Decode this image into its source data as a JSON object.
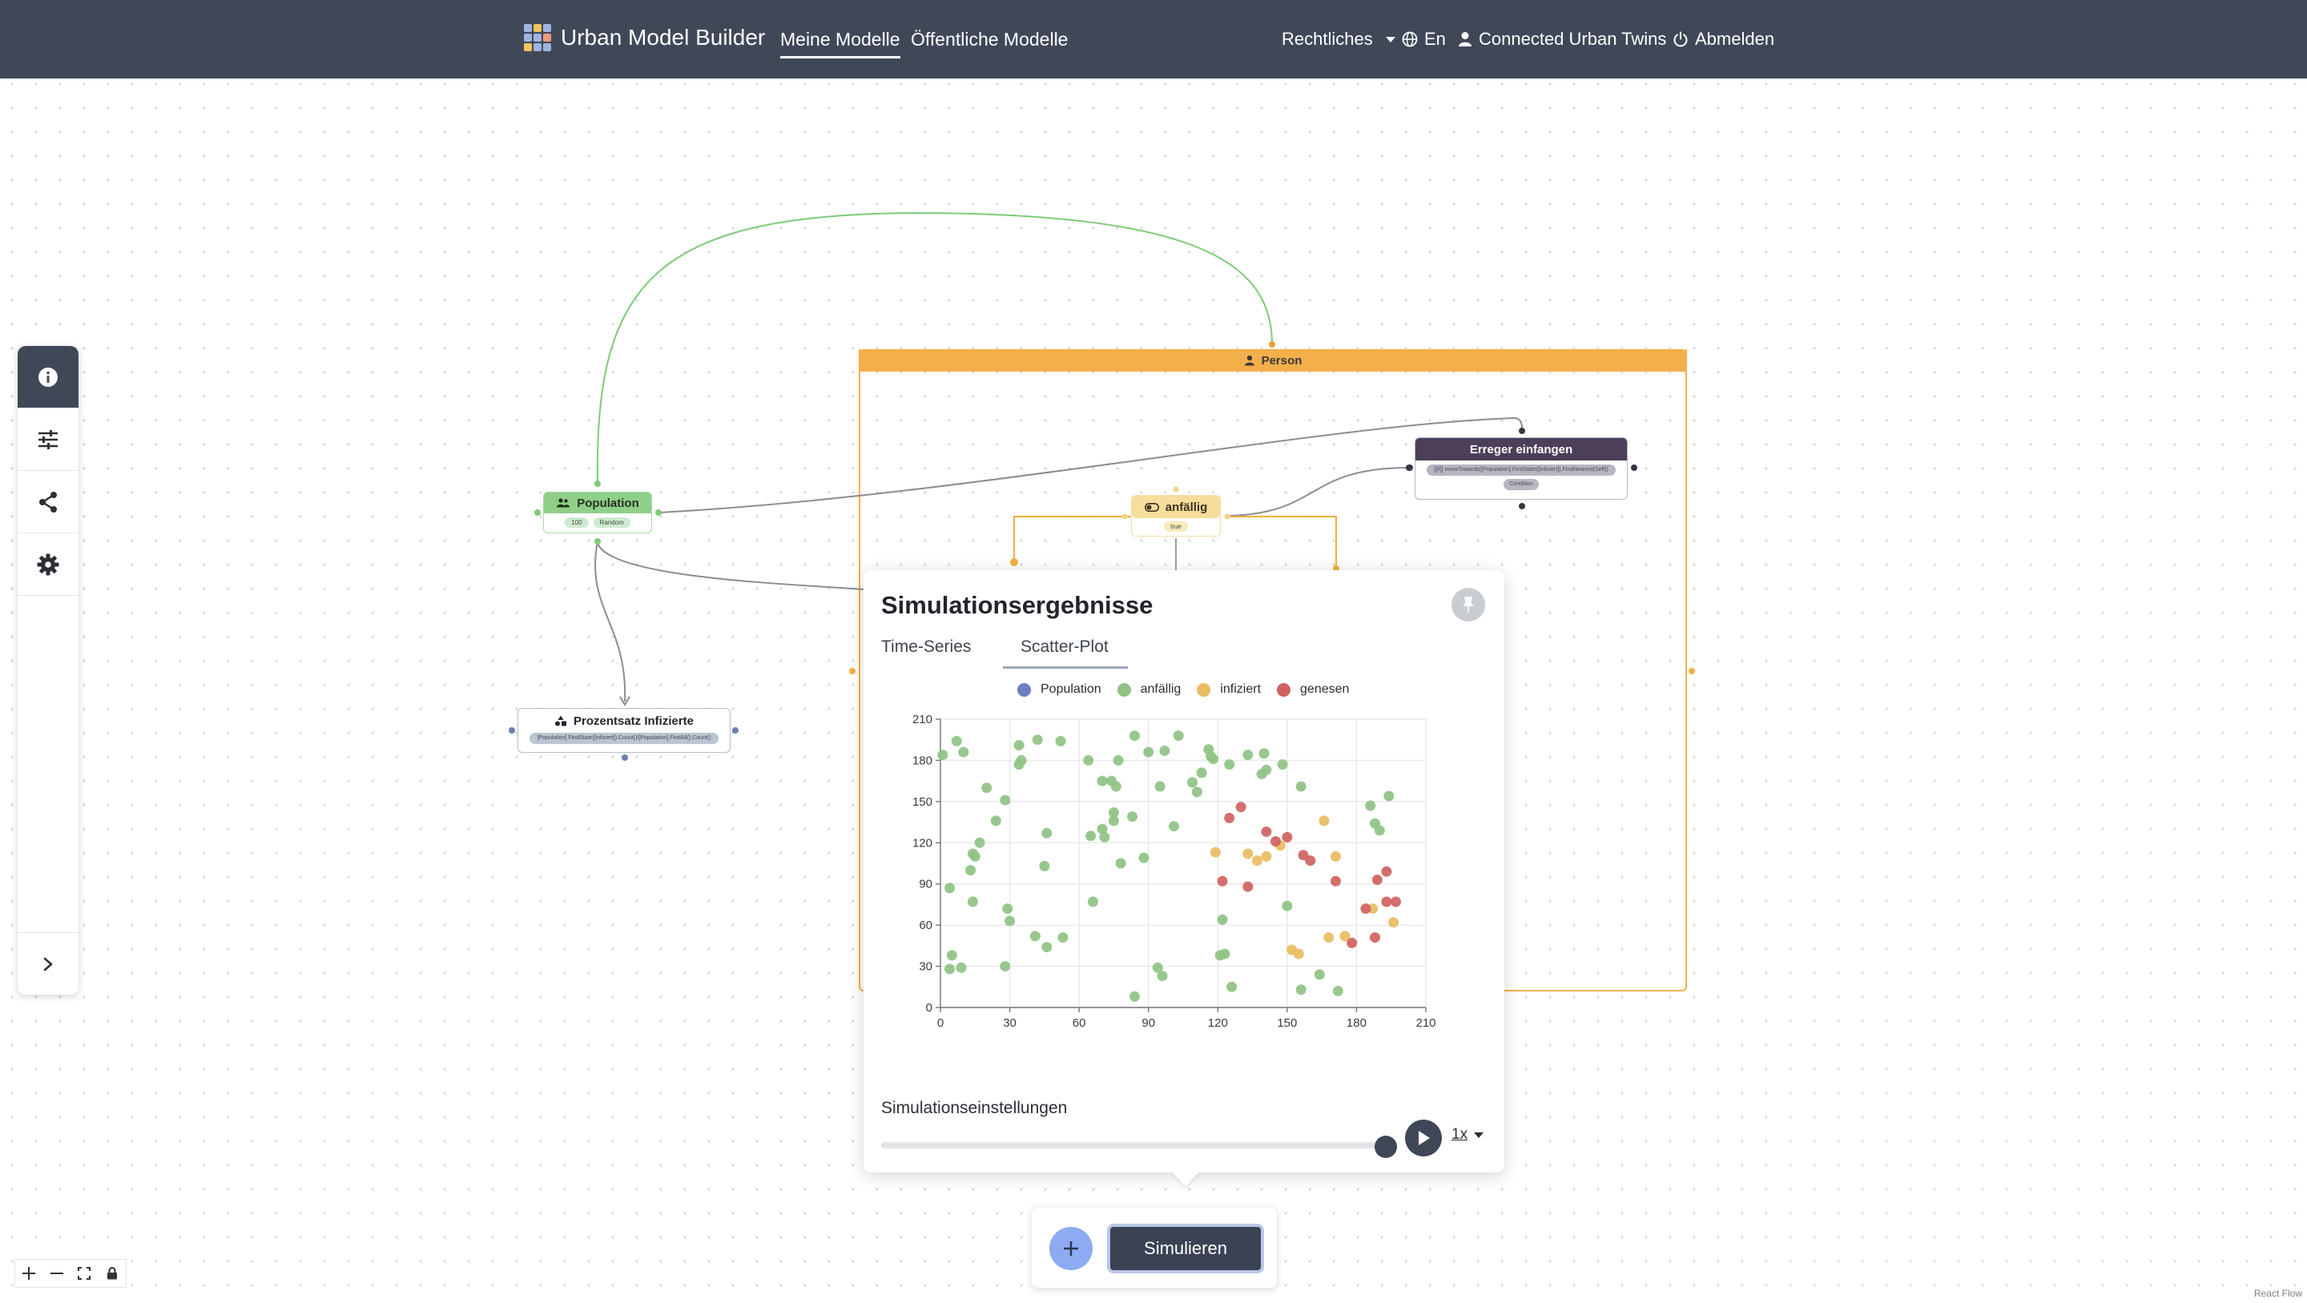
{
  "navbar": {
    "brand": "Urban Model Builder",
    "links": [
      {
        "label": "Meine Modelle",
        "active": true
      },
      {
        "label": "Öffentliche Modelle",
        "active": false
      }
    ],
    "legal": "Rechtliches",
    "language": "En",
    "user": "Connected Urban Twins",
    "logout": "Abmelden"
  },
  "colors": {
    "navbar": "#404858",
    "population": "#8fcf88",
    "person": "#f3af4a",
    "anfaellig": "#f7dd9c",
    "erreger": "#4b3f5a"
  },
  "sidebar": {
    "icons": [
      "info-icon",
      "sliders-icon",
      "share-icon",
      "gear-icon"
    ],
    "collapse_icon": "chevron-right-icon"
  },
  "nodes": {
    "person": {
      "label": "Person"
    },
    "population": {
      "label": "Population",
      "pills": [
        "100",
        "Random"
      ]
    },
    "anfaellig": {
      "label": "anfällig",
      "pill": "true"
    },
    "erreger": {
      "label": "Erreger einfangen",
      "formula": "[[if]] moveTowards([Population].FindState([infiziert]).FindNearest(Self))",
      "pill": "Condition"
    },
    "prozentsatz": {
      "label": "Prozentsatz Infizierte",
      "formula": "[Population].FindState([infiziert]).Count()/[Population].FindAll().Count()"
    }
  },
  "simulation": {
    "title": "Simulationsergebnisse",
    "tabs": [
      {
        "label": "Time-Series",
        "active": false
      },
      {
        "label": "Scatter-Plot",
        "active": true
      }
    ],
    "settings_label": "Simulationseinstellungen",
    "speed": "1x",
    "progress": 1.0
  },
  "chart_data": {
    "type": "scatter",
    "xlim": [
      0,
      210
    ],
    "ylim": [
      0,
      210
    ],
    "xticks": [
      0,
      30,
      60,
      90,
      120,
      150,
      180,
      210
    ],
    "yticks": [
      0,
      30,
      60,
      90,
      120,
      150,
      180,
      210
    ],
    "grid": true,
    "legend": "top",
    "series": [
      {
        "name": "Population",
        "color": "#6a7fc0",
        "points": []
      },
      {
        "name": "anfällig",
        "color": "#8fc283",
        "points": [
          [
            1,
            184
          ],
          [
            7,
            194
          ],
          [
            10,
            186
          ],
          [
            20,
            160
          ],
          [
            28,
            151
          ],
          [
            24,
            136
          ],
          [
            14,
            112
          ],
          [
            17,
            120
          ],
          [
            13,
            100
          ],
          [
            15,
            110
          ],
          [
            4,
            87
          ],
          [
            14,
            77
          ],
          [
            5,
            38
          ],
          [
            4,
            28
          ],
          [
            9,
            29
          ],
          [
            29,
            72
          ],
          [
            30,
            63
          ],
          [
            28,
            30
          ],
          [
            34,
            191
          ],
          [
            35,
            180
          ],
          [
            34,
            177
          ],
          [
            42,
            195
          ],
          [
            46,
            127
          ],
          [
            45,
            103
          ],
          [
            52,
            194
          ],
          [
            41,
            52
          ],
          [
            46,
            44
          ],
          [
            53,
            51
          ],
          [
            64,
            180
          ],
          [
            70,
            165
          ],
          [
            65,
            125
          ],
          [
            70,
            130
          ],
          [
            71,
            124
          ],
          [
            75,
            136
          ],
          [
            76,
            161
          ],
          [
            77,
            180
          ],
          [
            74,
            165
          ],
          [
            75,
            142
          ],
          [
            78,
            105
          ],
          [
            66,
            77
          ],
          [
            83,
            139
          ],
          [
            84,
            198
          ],
          [
            88,
            109
          ],
          [
            90,
            186
          ],
          [
            97,
            187
          ],
          [
            95,
            161
          ],
          [
            101,
            132
          ],
          [
            103,
            198
          ],
          [
            109,
            164
          ],
          [
            111,
            157
          ],
          [
            113,
            171
          ],
          [
            116,
            188
          ],
          [
            117,
            183
          ],
          [
            118,
            181
          ],
          [
            122,
            64
          ],
          [
            123,
            39
          ],
          [
            125,
            177
          ],
          [
            121,
            38
          ],
          [
            126,
            15
          ],
          [
            133,
            184
          ],
          [
            139,
            170
          ],
          [
            141,
            173
          ],
          [
            140,
            185
          ],
          [
            148,
            177
          ],
          [
            156,
            161
          ],
          [
            150,
            74
          ],
          [
            156,
            13
          ],
          [
            164,
            24
          ],
          [
            172,
            12
          ],
          [
            190,
            129
          ],
          [
            186,
            147
          ],
          [
            188,
            134
          ],
          [
            194,
            154
          ],
          [
            84,
            8
          ],
          [
            94,
            29
          ],
          [
            96,
            23
          ]
        ]
      },
      {
        "name": "infiziert",
        "color": "#e8bc61",
        "points": [
          [
            119,
            113
          ],
          [
            133,
            112
          ],
          [
            137,
            107
          ],
          [
            141,
            110
          ],
          [
            147,
            118
          ],
          [
            166,
            136
          ],
          [
            168,
            51
          ],
          [
            171,
            110
          ],
          [
            175,
            52
          ],
          [
            187,
            72
          ],
          [
            196,
            62
          ],
          [
            152,
            42
          ],
          [
            155,
            39
          ]
        ]
      },
      {
        "name": "genesen",
        "color": "#d06262",
        "points": [
          [
            125,
            138
          ],
          [
            130,
            146
          ],
          [
            122,
            92
          ],
          [
            133,
            88
          ],
          [
            141,
            128
          ],
          [
            145,
            121
          ],
          [
            150,
            124
          ],
          [
            157,
            111
          ],
          [
            160,
            107
          ],
          [
            171,
            92
          ],
          [
            178,
            47
          ],
          [
            184,
            72
          ],
          [
            188,
            51
          ],
          [
            189,
            93
          ],
          [
            193,
            99
          ],
          [
            193,
            77
          ],
          [
            197,
            77
          ]
        ]
      }
    ]
  },
  "toolbar": {
    "add_icon": "plus-icon",
    "simulate": "Simulieren"
  },
  "zoom": {
    "icons": [
      "zoom-in-icon",
      "zoom-out-icon",
      "fit-view-icon",
      "lock-icon"
    ]
  },
  "attribution": "React Flow"
}
